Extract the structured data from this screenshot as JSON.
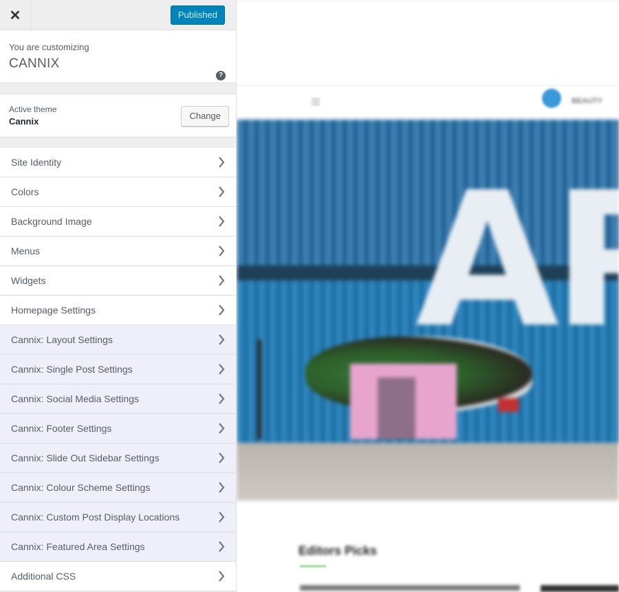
{
  "topbar": {
    "close_label": "✕",
    "publish_label": "Published"
  },
  "info": {
    "pre_title": "You are customizing",
    "site_name": "CANNIX",
    "help_symbol": "?"
  },
  "theme": {
    "label": "Active theme",
    "name": "Cannix",
    "change_label": "Change"
  },
  "menu": {
    "items": [
      {
        "label": "Site Identity"
      },
      {
        "label": "Colors"
      },
      {
        "label": "Background Image"
      },
      {
        "label": "Menus"
      },
      {
        "label": "Widgets"
      },
      {
        "label": "Homepage Settings"
      },
      {
        "label": "Cannix: Layout Settings"
      },
      {
        "label": "Cannix: Single Post Settings"
      },
      {
        "label": "Cannix: Social Media Settings"
      },
      {
        "label": "Cannix: Footer Settings"
      },
      {
        "label": "Cannix: Slide Out Sidebar Settings"
      },
      {
        "label": "Cannix: Colour Scheme Settings"
      },
      {
        "label": "Cannix: Custom Post Display Locations"
      },
      {
        "label": "Cannix: Featured Area Settings"
      },
      {
        "label": "Additional CSS"
      }
    ]
  },
  "preview": {
    "nav_text": "BEAUTY",
    "hero_text": "AR",
    "section_heading": "Editors Picks"
  },
  "colors": {
    "accent": "#0085ba",
    "theme_section_bg": "#efeff9",
    "panel_bg": "#eeeeee"
  }
}
